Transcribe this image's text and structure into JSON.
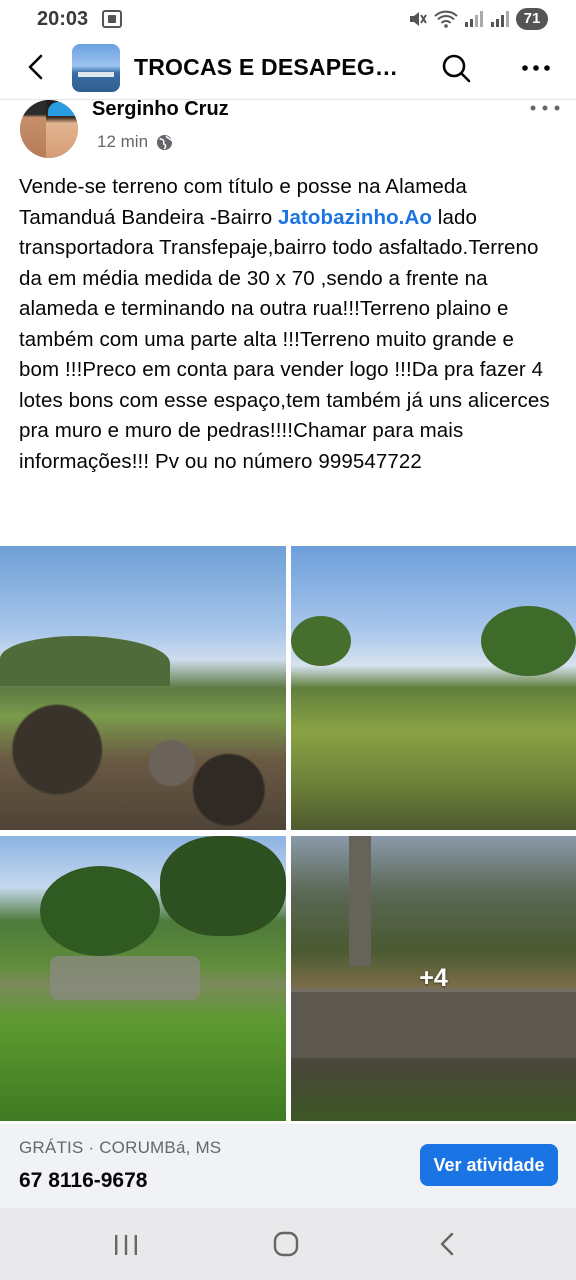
{
  "status_bar": {
    "time": "20:03",
    "battery": "71"
  },
  "header": {
    "group_title": "TROCAS E DESAPEGOS CORUMBÁ"
  },
  "post": {
    "author": "Serginho Cruz",
    "time_ago": "12 min",
    "text_before_link": "Vende-se terreno com título e posse na Alameda Tamanduá Bandeira -Bairro ",
    "link_text": "Jatobazinho.Ao",
    "text_after_link": " lado transportadora Transfepaje,bairro todo asfaltado.Terreno da em média  medida de 30 x 70 ,sendo a frente na alameda e terminando na outra rua!!!Terreno plaino e também com uma parte alta !!!Terreno muito grande e bom !!!Preco em conta para vender logo !!!Da pra fazer 4 lotes bons com esse espaço,tem também já uns alicerces pra muro e muro de pedras!!!!Chamar para mais informações!!! Pv ou no número 999547722",
    "more_photos_count": "+4"
  },
  "listing": {
    "meta": "GRÁTIS · CORUMBá, MS",
    "phone": "67 8116-9678",
    "cta_label": "Ver atividade"
  },
  "icons": {
    "back": "chevron-left-icon",
    "search": "search-icon",
    "more": "more-horizontal-icon",
    "globe": "globe-icon"
  },
  "colors": {
    "link": "#1b74e4",
    "button": "#1b74e4",
    "muted_text": "#65676b"
  }
}
